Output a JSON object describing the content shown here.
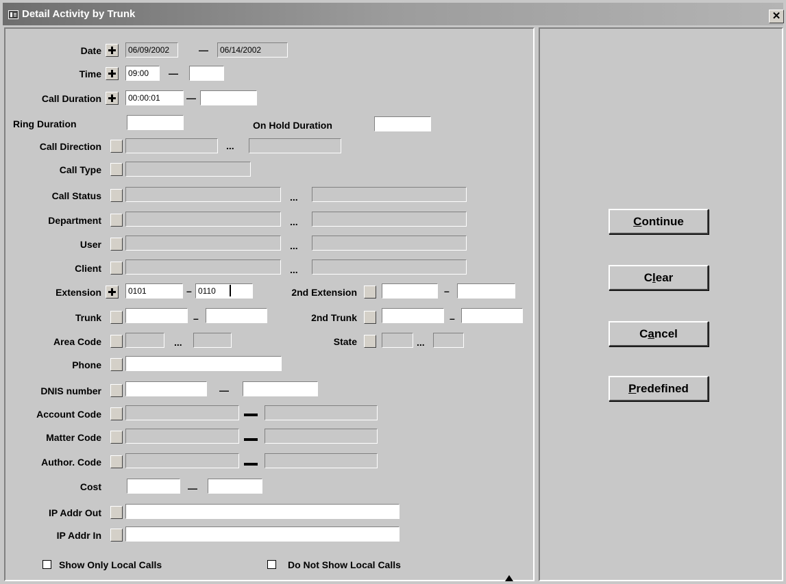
{
  "window": {
    "title": "Detail Activity by Trunk",
    "close_glyph": "✕",
    "icon": "form-icon"
  },
  "form": {
    "date": {
      "label": "Date",
      "from": "06/09/2002",
      "sep": "—",
      "to": "06/14/2002"
    },
    "time": {
      "label": "Time",
      "from": "09:00",
      "sep": "—",
      "to": ""
    },
    "call_duration": {
      "label": "Call Duration",
      "from": "00:00:01",
      "sep": "—",
      "to": ""
    },
    "ring_duration": {
      "label": "Ring Duration",
      "value": ""
    },
    "on_hold_duration": {
      "label": "On Hold Duration",
      "value": ""
    },
    "call_direction": {
      "label": "Call Direction",
      "sep": "...",
      "from": "",
      "to": ""
    },
    "call_type": {
      "label": "Call Type",
      "value": ""
    },
    "call_status": {
      "label": "Call Status",
      "sep": "...",
      "from": "",
      "to": ""
    },
    "department": {
      "label": "Department",
      "sep": "...",
      "from": "",
      "to": ""
    },
    "user": {
      "label": "User",
      "sep": "...",
      "from": "",
      "to": ""
    },
    "client": {
      "label": "Client",
      "sep": "...",
      "from": "",
      "to": ""
    },
    "extension": {
      "label": "Extension",
      "from": "0101",
      "sep": "–",
      "to": "0110"
    },
    "second_extension": {
      "label": "2nd Extension",
      "sep": "–",
      "from": "",
      "to": ""
    },
    "trunk": {
      "label": "Trunk",
      "sep": "–",
      "from": "",
      "to": ""
    },
    "second_trunk": {
      "label": "2nd Trunk",
      "sep": "–",
      "from": "",
      "to": ""
    },
    "area_code": {
      "label": "Area Code",
      "sep": "...",
      "from": "",
      "to": ""
    },
    "state": {
      "label": "State",
      "sep": "...",
      "from": "",
      "to": ""
    },
    "phone": {
      "label": "Phone",
      "value": ""
    },
    "dnis_number": {
      "label": "DNIS number",
      "sep": "—",
      "from": "",
      "to": ""
    },
    "account_code": {
      "label": "Account Code",
      "from": "",
      "to": ""
    },
    "matter_code": {
      "label": "Matter Code",
      "from": "",
      "to": ""
    },
    "author_code": {
      "label": "Author. Code",
      "from": "",
      "to": ""
    },
    "cost": {
      "label": "Cost",
      "sep": "—",
      "from": "",
      "to": ""
    },
    "ip_addr_out": {
      "label": "IP Addr Out",
      "value": ""
    },
    "ip_addr_in": {
      "label": "IP Addr In",
      "value": ""
    },
    "show_only_local_calls": {
      "label": "Show Only Local Calls",
      "checked": false
    },
    "do_not_show_local_calls": {
      "label": "Do Not Show Local Calls",
      "checked": false
    }
  },
  "buttons": {
    "continue": {
      "pre": "",
      "key": "C",
      "post": "ontinue"
    },
    "clear": {
      "pre": "C",
      "key": "l",
      "post": "ear"
    },
    "cancel": {
      "pre": "C",
      "key": "a",
      "post": "ncel"
    },
    "predefined": {
      "pre": "",
      "key": "P",
      "post": "redefined"
    }
  },
  "colors": {
    "window_bg": "#c8c8c8",
    "title_bg": "#808080",
    "title_text": "#ffffff"
  }
}
